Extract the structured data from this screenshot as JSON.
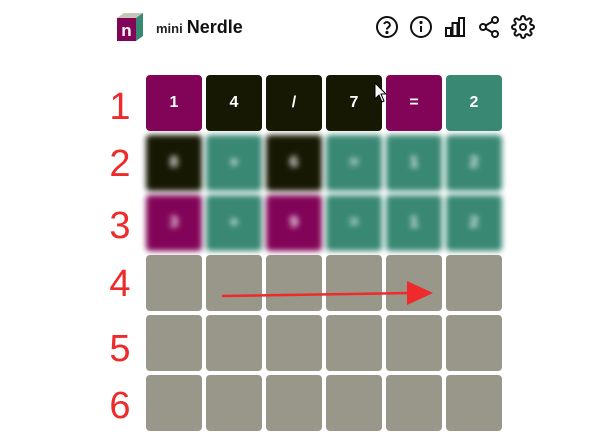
{
  "header": {
    "mini_label": "mini",
    "title": "Nerdle",
    "icons": [
      "help-icon",
      "info-icon",
      "stats-icon",
      "share-icon",
      "settings-icon"
    ]
  },
  "colors": {
    "purple": "#820458",
    "black": "#161803",
    "green": "#398874",
    "empty": "#99978a",
    "annotation": "#ee2a2a"
  },
  "row_numbers": [
    "1",
    "2",
    "3",
    "4",
    "5",
    "6"
  ],
  "board": {
    "rows": [
      [
        {
          "text": "1",
          "state": "purple"
        },
        {
          "text": "4",
          "state": "black"
        },
        {
          "text": "/",
          "state": "black"
        },
        {
          "text": "7",
          "state": "black"
        },
        {
          "text": "=",
          "state": "purple"
        },
        {
          "text": "2",
          "state": "green"
        }
      ],
      [
        {
          "text": "8",
          "state": "black"
        },
        {
          "text": "+",
          "state": "green"
        },
        {
          "text": "6",
          "state": "black"
        },
        {
          "text": "=",
          "state": "green"
        },
        {
          "text": "1",
          "state": "green"
        },
        {
          "text": "2",
          "state": "green"
        }
      ],
      [
        {
          "text": "3",
          "state": "purple"
        },
        {
          "text": "+",
          "state": "green"
        },
        {
          "text": "9",
          "state": "purple"
        },
        {
          "text": "=",
          "state": "green"
        },
        {
          "text": "1",
          "state": "green"
        },
        {
          "text": "2",
          "state": "green"
        }
      ],
      [
        {
          "text": "",
          "state": "empty"
        },
        {
          "text": "",
          "state": "empty"
        },
        {
          "text": "",
          "state": "empty"
        },
        {
          "text": "",
          "state": "empty"
        },
        {
          "text": "",
          "state": "empty"
        },
        {
          "text": "",
          "state": "empty"
        }
      ],
      [
        {
          "text": "",
          "state": "empty"
        },
        {
          "text": "",
          "state": "empty"
        },
        {
          "text": "",
          "state": "empty"
        },
        {
          "text": "",
          "state": "empty"
        },
        {
          "text": "",
          "state": "empty"
        },
        {
          "text": "",
          "state": "empty"
        }
      ],
      [
        {
          "text": "",
          "state": "empty"
        },
        {
          "text": "",
          "state": "empty"
        },
        {
          "text": "",
          "state": "empty"
        },
        {
          "text": "",
          "state": "empty"
        },
        {
          "text": "",
          "state": "empty"
        },
        {
          "text": "",
          "state": "empty"
        }
      ]
    ],
    "blurred_rows": [
      1,
      2
    ]
  }
}
